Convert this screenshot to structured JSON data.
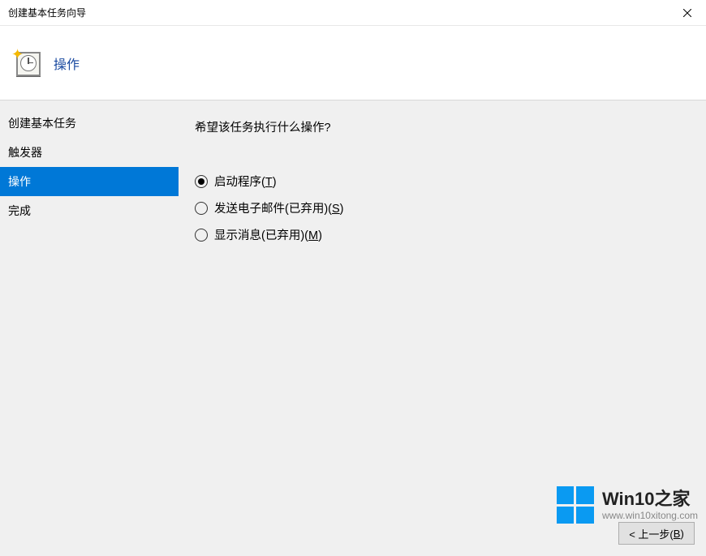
{
  "window": {
    "title": "创建基本任务向导"
  },
  "header": {
    "title": "操作"
  },
  "sidebar": {
    "items": [
      {
        "label": "创建基本任务",
        "selected": false
      },
      {
        "label": "触发器",
        "selected": false
      },
      {
        "label": "操作",
        "selected": true
      },
      {
        "label": "完成",
        "selected": false
      }
    ]
  },
  "main": {
    "prompt": "希望该任务执行什么操作?",
    "options": [
      {
        "label_pre": "启动程序(",
        "hotkey": "T",
        "label_post": ")",
        "checked": true
      },
      {
        "label_pre": "发送电子邮件(已弃用)(",
        "hotkey": "S",
        "label_post": ")",
        "checked": false
      },
      {
        "label_pre": "显示消息(已弃用)(",
        "hotkey": "M",
        "label_post": ")",
        "checked": false
      }
    ]
  },
  "footer": {
    "back_pre": "< 上一步(",
    "back_key": "B",
    "back_post": ")"
  },
  "watermark": {
    "main_a": "Win10",
    "main_b": "之家",
    "sub": "www.win10xitong.com"
  }
}
